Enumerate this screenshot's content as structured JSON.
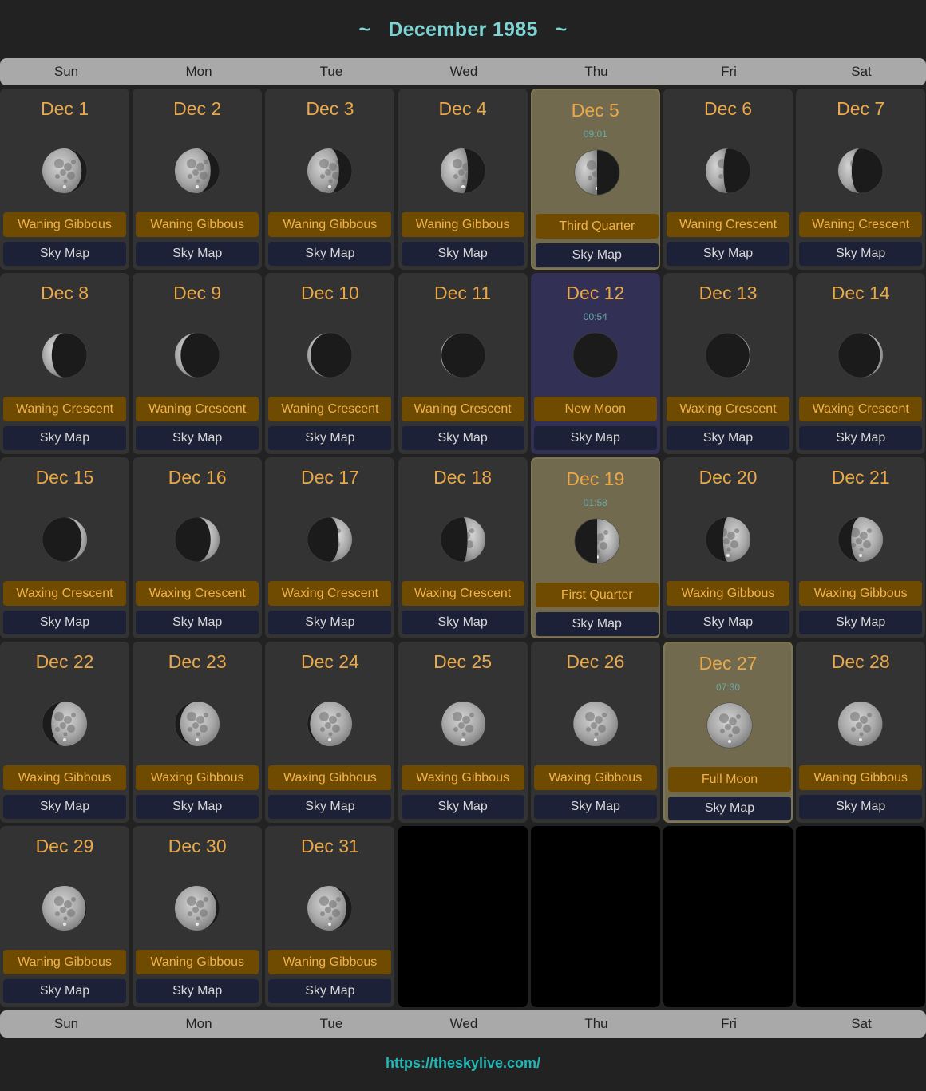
{
  "header": {
    "title": "December 1985",
    "tilde_left": "~",
    "tilde_right": "~"
  },
  "weekdays": [
    "Sun",
    "Mon",
    "Tue",
    "Wed",
    "Thu",
    "Fri",
    "Sat"
  ],
  "sky_map_label": "Sky Map",
  "leading_empty_days": 0,
  "trailing_empty_days": 4,
  "colors": {
    "date": "#e9a84a",
    "phase_bg": "#6e4b00",
    "phase_text": "#f0b24e",
    "skymap_bg": "#1c2138",
    "highlight_major": "#716a4e",
    "highlight_new_moon": "#323055",
    "title": "#7fd3d3",
    "footer_link": "#22b8b8"
  },
  "days": [
    {
      "date": "Dec 1",
      "phase": "Waning Gibbous",
      "illumination": 0.88,
      "waxing": false
    },
    {
      "date": "Dec 2",
      "phase": "Waning Gibbous",
      "illumination": 0.8,
      "waxing": false
    },
    {
      "date": "Dec 3",
      "phase": "Waning Gibbous",
      "illumination": 0.71,
      "waxing": false
    },
    {
      "date": "Dec 4",
      "phase": "Waning Gibbous",
      "illumination": 0.61,
      "waxing": false
    },
    {
      "date": "Dec 5",
      "phase": "Third Quarter",
      "time": "09:01",
      "illumination": 0.5,
      "waxing": false,
      "highlight": "gold"
    },
    {
      "date": "Dec 6",
      "phase": "Waning Crescent",
      "illumination": 0.4,
      "waxing": false
    },
    {
      "date": "Dec 7",
      "phase": "Waning Crescent",
      "illumination": 0.3,
      "waxing": false
    },
    {
      "date": "Dec 8",
      "phase": "Waning Crescent",
      "illumination": 0.21,
      "waxing": false
    },
    {
      "date": "Dec 9",
      "phase": "Waning Crescent",
      "illumination": 0.13,
      "waxing": false
    },
    {
      "date": "Dec 10",
      "phase": "Waning Crescent",
      "illumination": 0.07,
      "waxing": false
    },
    {
      "date": "Dec 11",
      "phase": "Waning Crescent",
      "illumination": 0.02,
      "waxing": false
    },
    {
      "date": "Dec 12",
      "phase": "New Moon",
      "time": "00:54",
      "illumination": 0.0,
      "waxing": true,
      "highlight": "blue"
    },
    {
      "date": "Dec 13",
      "phase": "Waxing Crescent",
      "illumination": 0.02,
      "waxing": true
    },
    {
      "date": "Dec 14",
      "phase": "Waxing Crescent",
      "illumination": 0.06,
      "waxing": true
    },
    {
      "date": "Dec 15",
      "phase": "Waxing Crescent",
      "illumination": 0.12,
      "waxing": true
    },
    {
      "date": "Dec 16",
      "phase": "Waxing Crescent",
      "illumination": 0.2,
      "waxing": true
    },
    {
      "date": "Dec 17",
      "phase": "Waxing Crescent",
      "illumination": 0.3,
      "waxing": true
    },
    {
      "date": "Dec 18",
      "phase": "Waxing Crescent",
      "illumination": 0.4,
      "waxing": true
    },
    {
      "date": "Dec 19",
      "phase": "First Quarter",
      "time": "01:58",
      "illumination": 0.5,
      "waxing": true,
      "highlight": "gold"
    },
    {
      "date": "Dec 20",
      "phase": "Waxing Gibbous",
      "illumination": 0.61,
      "waxing": true
    },
    {
      "date": "Dec 21",
      "phase": "Waxing Gibbous",
      "illumination": 0.71,
      "waxing": true
    },
    {
      "date": "Dec 22",
      "phase": "Waxing Gibbous",
      "illumination": 0.8,
      "waxing": true
    },
    {
      "date": "Dec 23",
      "phase": "Waxing Gibbous",
      "illumination": 0.88,
      "waxing": true
    },
    {
      "date": "Dec 24",
      "phase": "Waxing Gibbous",
      "illumination": 0.94,
      "waxing": true
    },
    {
      "date": "Dec 25",
      "phase": "Waxing Gibbous",
      "illumination": 0.98,
      "waxing": true
    },
    {
      "date": "Dec 26",
      "phase": "Waxing Gibbous",
      "illumination": 0.995,
      "waxing": true
    },
    {
      "date": "Dec 27",
      "phase": "Full Moon",
      "time": "07:30",
      "illumination": 1.0,
      "waxing": false,
      "highlight": "gold"
    },
    {
      "date": "Dec 28",
      "phase": "Waning Gibbous",
      "illumination": 0.99,
      "waxing": false
    },
    {
      "date": "Dec 29",
      "phase": "Waning Gibbous",
      "illumination": 0.97,
      "waxing": false
    },
    {
      "date": "Dec 30",
      "phase": "Waning Gibbous",
      "illumination": 0.93,
      "waxing": false
    },
    {
      "date": "Dec 31",
      "phase": "Waning Gibbous",
      "illumination": 0.87,
      "waxing": false
    }
  ],
  "footer": {
    "link": "https://theskylive.com/"
  }
}
